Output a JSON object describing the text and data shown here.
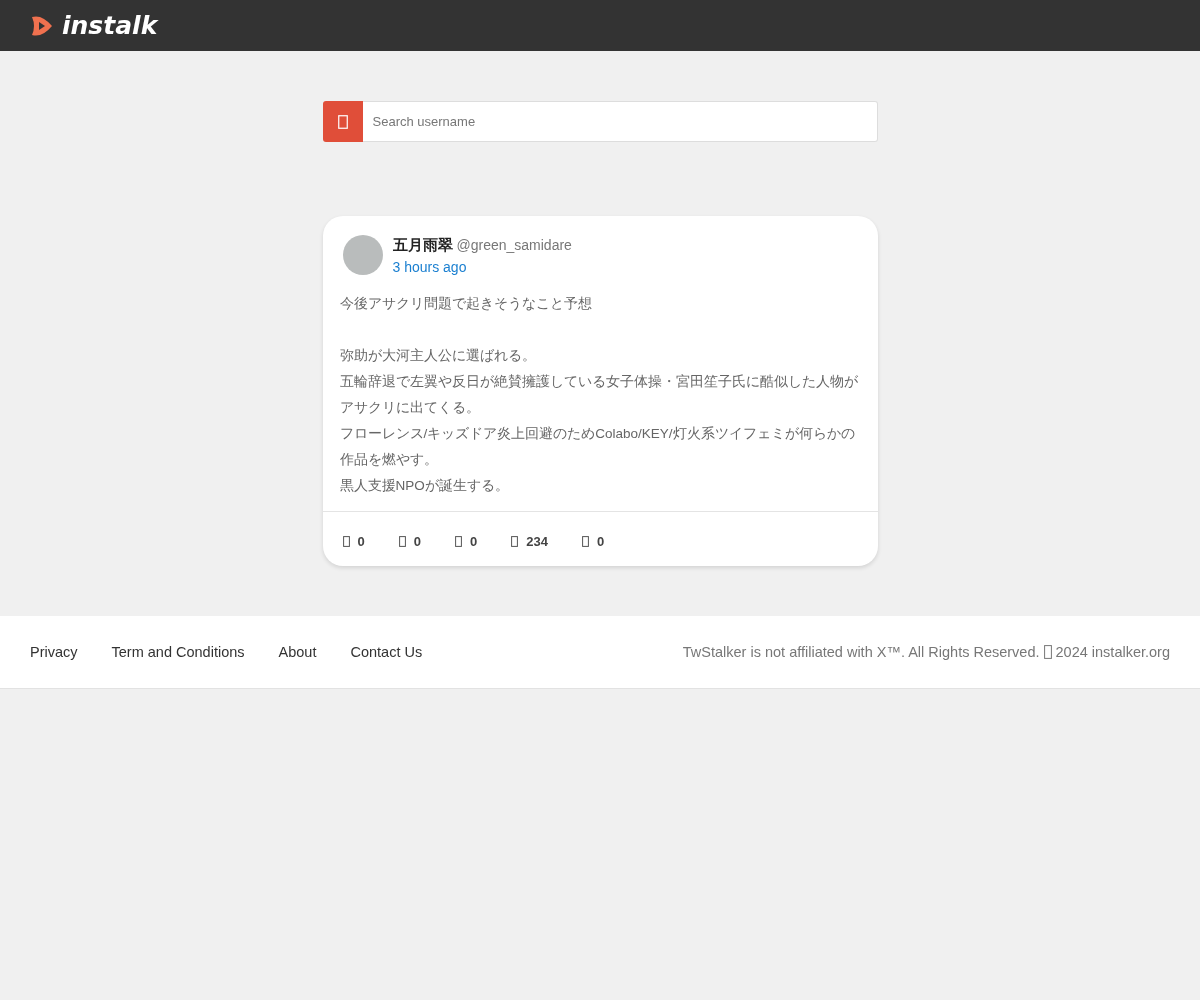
{
  "header": {
    "logo_text": "instalk"
  },
  "search": {
    "placeholder": "Search username"
  },
  "post": {
    "name": "五月雨翠",
    "handle": "@green_samidare",
    "time": "3 hours ago",
    "paragraphs": [
      [
        "今後アサクリ問題で起きそうなこと予想"
      ],
      [
        "弥助が大河主人公に選ばれる。",
        "五輪辞退で左翼や反日が絶賛擁護している女子体操・宮田笙子氏に酷似した人物がアサクリに出てくる。",
        "フローレンス/キッズドア炎上回避のためColabo/KEY/灯火系ツイフェミが何らかの作品を燃やす。",
        "黒人支援NPOが誕生する。"
      ]
    ],
    "stats": [
      "0",
      "0",
      "0",
      "234",
      "0"
    ]
  },
  "footer": {
    "links": [
      "Privacy",
      "Term and Conditions",
      "About",
      "Contact Us"
    ],
    "notice": "TwStalker is not affiliated with X™. All Rights Reserved.",
    "copyright": "2024 instalker.org"
  }
}
